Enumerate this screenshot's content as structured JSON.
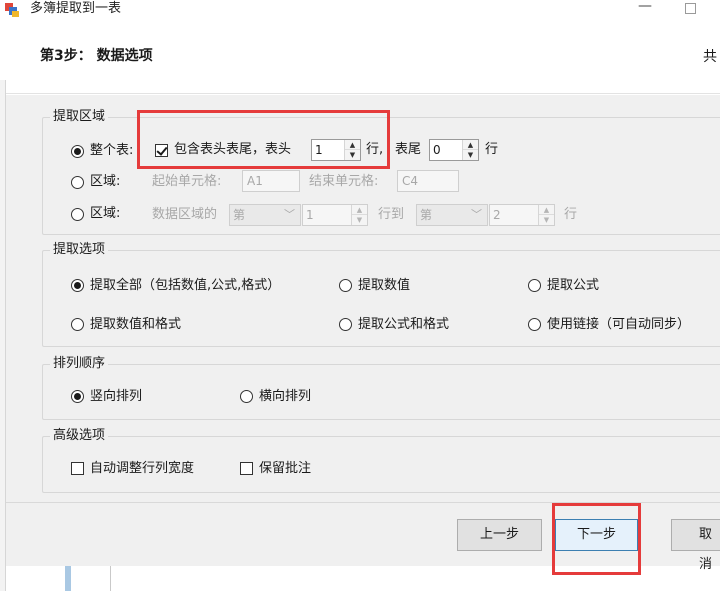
{
  "window": {
    "title": "多簿提取到一表"
  },
  "header": {
    "step_title": "第3步： 数据选项",
    "right_text": "共"
  },
  "extract_region": {
    "title": "提取区域",
    "whole_table": {
      "label": "整个表:",
      "include_header_footer_label": "包含表头表尾，表头",
      "header_rows": "1",
      "header_unit": "行,",
      "footer_label": "表尾",
      "footer_rows": "0",
      "footer_unit": "行"
    },
    "range_cells": {
      "label": "区域:",
      "start_label": "起始单元格:",
      "start_value": "A1",
      "end_label": "结束单元格:",
      "end_value": "C4"
    },
    "range_rows": {
      "label": "区域:",
      "prefix": "数据区域的",
      "from_combo": "第",
      "from_value": "1",
      "to_label": "行到",
      "to_combo": "第",
      "to_value": "2",
      "unit": "行"
    }
  },
  "extract_options": {
    "title": "提取选项",
    "all": "提取全部（包括数值,公式,格式）",
    "values": "提取数值",
    "formulas": "提取公式",
    "values_formats": "提取数值和格式",
    "formulas_formats": "提取公式和格式",
    "links": "使用链接（可自动同步）"
  },
  "order": {
    "title": "排列顺序",
    "vertical": "竖向排列",
    "horizontal": "横向排列"
  },
  "advanced": {
    "title": "高级选项",
    "autofit": "自动调整行列宽度",
    "keep_comments": "保留批注"
  },
  "footer": {
    "prev": "上一步",
    "next": "下一步",
    "cancel": "取消"
  },
  "colors": {
    "highlight": "#e53b3b",
    "dialog_bg": "#f0f0f0"
  }
}
